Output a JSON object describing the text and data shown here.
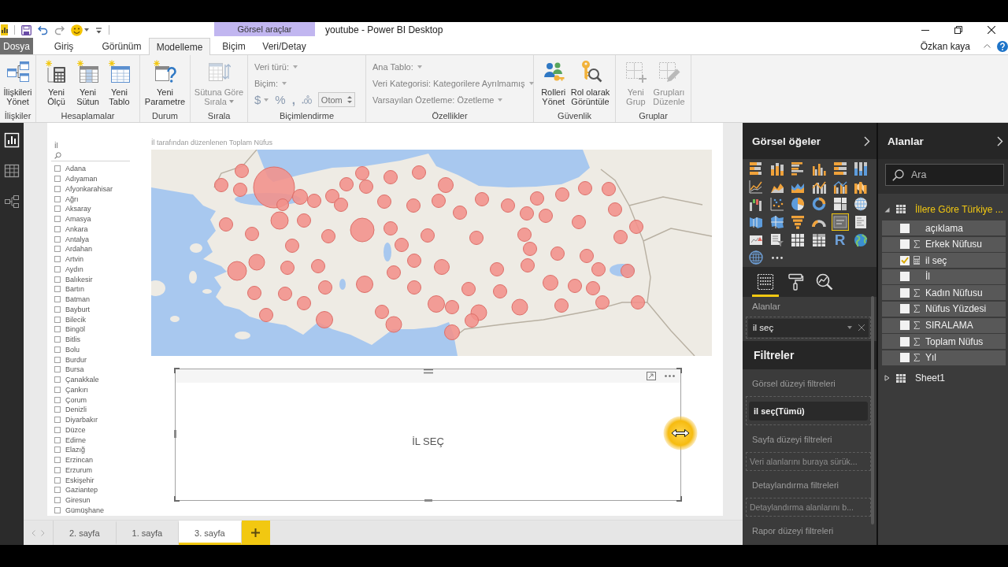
{
  "title_bar": {
    "contextual_group": "Görsel araçlar",
    "title": "youtube - Power BI Desktop"
  },
  "ribbon_tabs": [
    {
      "label": "Dosya",
      "kind": "file",
      "selected": false
    },
    {
      "label": "Giriş",
      "kind": "tab",
      "selected": false
    },
    {
      "label": "Görünüm",
      "kind": "tab",
      "selected": false
    },
    {
      "label": "Modelleme",
      "kind": "tab",
      "selected": true
    },
    {
      "label": "Biçim",
      "kind": "contextual",
      "selected": false
    },
    {
      "label": "Veri/Detay",
      "kind": "contextual",
      "selected": false
    }
  ],
  "account": {
    "user": "Özkan kaya"
  },
  "ribbon_groups": [
    {
      "label": "İlişkiler",
      "items": [
        {
          "kind": "large",
          "lines": [
            "İlişkileri",
            "Yönet"
          ],
          "disabled": false
        }
      ]
    },
    {
      "label": "Hesaplamalar",
      "items": [
        {
          "kind": "large",
          "lines": [
            "Yeni",
            "Ölçü"
          ],
          "disabled": false
        },
        {
          "kind": "large",
          "lines": [
            "Yeni",
            "Sütun"
          ],
          "disabled": false
        },
        {
          "kind": "large",
          "lines": [
            "Yeni",
            "Tablo"
          ],
          "disabled": false
        }
      ]
    },
    {
      "label": "Durum",
      "items": [
        {
          "kind": "large",
          "lines": [
            "Yeni",
            "Parametre"
          ],
          "disabled": false
        }
      ]
    },
    {
      "label": "Sırala",
      "items": [
        {
          "kind": "large",
          "lines": [
            "Sütuna Göre",
            "Sırala"
          ],
          "dropdown": true,
          "disabled": true
        }
      ]
    },
    {
      "label": "Biçimlendirme",
      "items": [
        {
          "kind": "dropdown",
          "label": "Veri türü:",
          "disabled": true
        },
        {
          "kind": "dropdown",
          "label": "Biçim:",
          "disabled": true
        },
        {
          "kind": "format_row",
          "currency": "$",
          "percent": "%",
          "thousands": ",",
          "value": "Otom",
          "disabled": true
        }
      ]
    },
    {
      "label": "Özellikler",
      "items": [
        {
          "kind": "dropdown",
          "label": "Ana Tablo:",
          "disabled": true
        },
        {
          "kind": "dropdown",
          "label": "Veri Kategorisi: Kategorilere Ayrılmamış",
          "disabled": true
        },
        {
          "kind": "dropdown",
          "label": "Varsayılan Özetleme: Özetleme",
          "disabled": true
        }
      ]
    },
    {
      "label": "Güvenlik",
      "items": [
        {
          "kind": "large",
          "lines": [
            "Rolleri",
            "Yönet"
          ],
          "disabled": false
        },
        {
          "kind": "large",
          "lines": [
            "Rol olarak",
            "Görüntüle"
          ],
          "disabled": false
        }
      ]
    },
    {
      "label": "Gruplar",
      "items": [
        {
          "kind": "large",
          "lines": [
            "Yeni",
            "Grup"
          ],
          "disabled": true
        },
        {
          "kind": "large",
          "lines": [
            "Grupları",
            "Düzenle"
          ],
          "disabled": true
        }
      ]
    }
  ],
  "left_nav": [
    {
      "selected": true
    },
    {
      "selected": false
    },
    {
      "selected": false
    }
  ],
  "slicer": {
    "title": "İl",
    "items": [
      {
        "label": "Adana",
        "checked": false
      },
      {
        "label": "Adıyaman",
        "checked": false
      },
      {
        "label": "Afyonkarahisar",
        "checked": false
      },
      {
        "label": "Ağrı",
        "checked": false
      },
      {
        "label": "Aksaray",
        "checked": false
      },
      {
        "label": "Amasya",
        "checked": false
      },
      {
        "label": "Ankara",
        "checked": false
      },
      {
        "label": "Antalya",
        "checked": false
      },
      {
        "label": "Ardahan",
        "checked": false
      },
      {
        "label": "Artvin",
        "checked": false
      },
      {
        "label": "Aydın",
        "checked": false
      },
      {
        "label": "Balıkesir",
        "checked": false
      },
      {
        "label": "Bartın",
        "checked": false
      },
      {
        "label": "Batman",
        "checked": false
      },
      {
        "label": "Bayburt",
        "checked": false
      },
      {
        "label": "Bilecik",
        "checked": false
      },
      {
        "label": "Bingöl",
        "checked": false
      },
      {
        "label": "Bitlis",
        "checked": false
      },
      {
        "label": "Bolu",
        "checked": false
      },
      {
        "label": "Burdur",
        "checked": false
      },
      {
        "label": "Bursa",
        "checked": false
      },
      {
        "label": "Çanakkale",
        "checked": false
      },
      {
        "label": "Çankırı",
        "checked": false
      },
      {
        "label": "Çorum",
        "checked": false
      },
      {
        "label": "Denizli",
        "checked": false
      },
      {
        "label": "Diyarbakır",
        "checked": false
      },
      {
        "label": "Düzce",
        "checked": false
      },
      {
        "label": "Edirne",
        "checked": false
      },
      {
        "label": "Elazığ",
        "checked": false
      },
      {
        "label": "Erzincan",
        "checked": false
      },
      {
        "label": "Erzurum",
        "checked": false
      },
      {
        "label": "Eskişehir",
        "checked": false
      },
      {
        "label": "Gaziantep",
        "checked": false
      },
      {
        "label": "Giresun",
        "checked": false
      },
      {
        "label": "Gümüşhane",
        "checked": false
      }
    ]
  },
  "map_visual": {
    "title": "İl tarafından düzenlenen Toplam Nüfus"
  },
  "card_visual": {
    "value": "İL SEÇ"
  },
  "page_tabs": [
    {
      "label": "2. sayfa",
      "selected": false
    },
    {
      "label": "1. sayfa",
      "selected": false
    },
    {
      "label": "3. sayfa",
      "selected": true
    }
  ],
  "viz_pane": {
    "title": "Görsel öğeler",
    "gallery": [
      {
        "selected": false
      },
      {
        "selected": false
      },
      {
        "selected": false
      },
      {
        "selected": false
      },
      {
        "selected": false
      },
      {
        "selected": false
      },
      {
        "selected": false
      },
      {
        "selected": false
      },
      {
        "selected": false
      },
      {
        "selected": false
      },
      {
        "selected": false
      },
      {
        "selected": false
      },
      {
        "selected": false
      },
      {
        "selected": false
      },
      {
        "selected": false
      },
      {
        "selected": false
      },
      {
        "selected": false
      },
      {
        "selected": false
      },
      {
        "selected": false
      },
      {
        "selected": false
      },
      {
        "selected": false
      },
      {
        "selected": false
      },
      {
        "selected": true
      },
      {
        "selected": false
      },
      {
        "selected": false
      },
      {
        "selected": false
      },
      {
        "selected": false
      },
      {
        "selected": false
      },
      {
        "selected": false,
        "glyph": "R"
      },
      {
        "selected": false
      },
      {
        "selected": false
      }
    ],
    "tabs": [
      {
        "selected": true
      },
      {
        "selected": false
      },
      {
        "selected": false
      }
    ],
    "well": {
      "label": "Alanlar",
      "value": "il seç"
    }
  },
  "filters": {
    "title": "Filtreler",
    "sections": [
      {
        "title": "Görsel düzeyi filtreleri",
        "kind": "card",
        "text": "il seç(Tümü)"
      },
      {
        "title": "Sayfa düzeyi filtreleri",
        "kind": "drop",
        "text": "Veri alanlarını buraya sürük..."
      },
      {
        "title": "Detaylandırma filtreleri",
        "kind": "drop",
        "text": "Detaylandırma alanlarını b..."
      },
      {
        "title": "Rapor düzeyi filtreleri",
        "kind": "drop"
      }
    ]
  },
  "fields_pane": {
    "title": "Alanlar",
    "search": {
      "placeholder": "Ara"
    },
    "tables": [
      {
        "name": "İllere Göre Türkiye ...",
        "in_use": true,
        "expanded": true,
        "children": [
          {
            "name": "açıklama",
            "kind": "column",
            "checked": false
          },
          {
            "name": "Erkek Nüfusu",
            "kind": "sum",
            "checked": false
          },
          {
            "name": "il seç",
            "kind": "measure",
            "checked": true
          },
          {
            "name": "İl",
            "kind": "column",
            "checked": false
          },
          {
            "name": "Kadın Nüfusu",
            "kind": "sum",
            "checked": false
          },
          {
            "name": "Nüfus Yüzdesi",
            "kind": "sum",
            "checked": false
          },
          {
            "name": "SIRALAMA",
            "kind": "sum",
            "checked": false
          },
          {
            "name": "Toplam Nüfus",
            "kind": "sum",
            "checked": false
          },
          {
            "name": "Yıl",
            "kind": "sum",
            "checked": false
          }
        ]
      },
      {
        "name": "Sheet1",
        "in_use": false,
        "expanded": false
      }
    ]
  }
}
